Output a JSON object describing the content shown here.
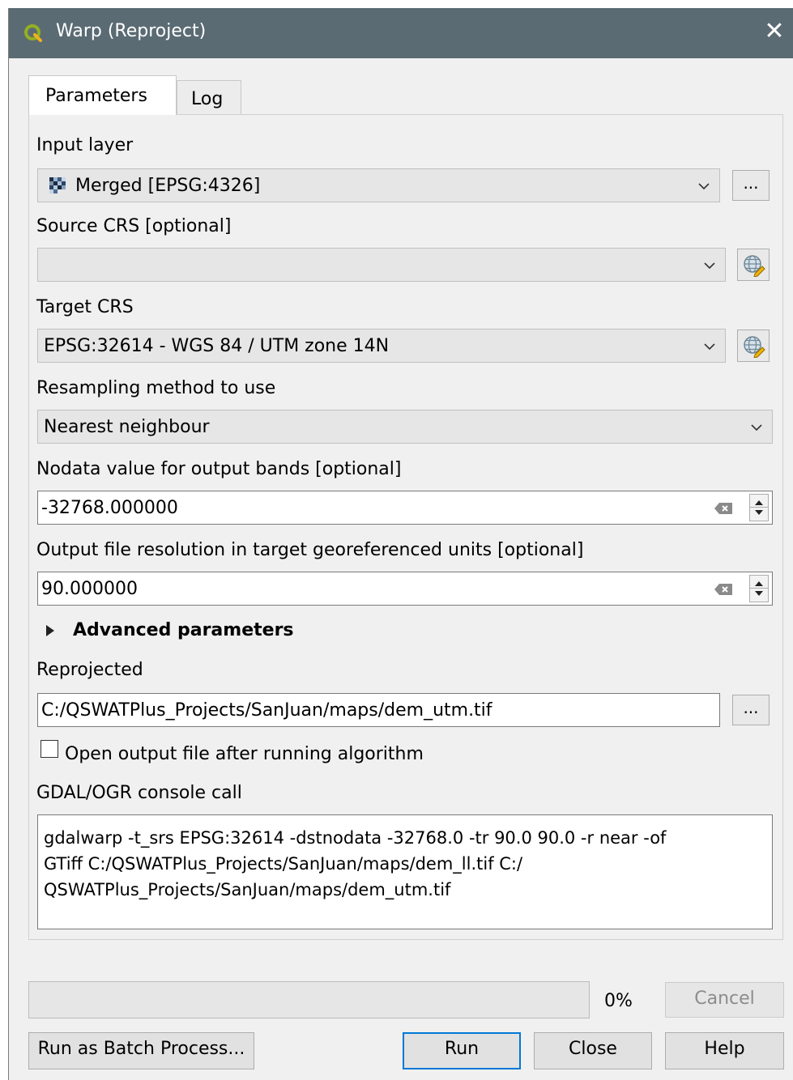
{
  "window": {
    "title": "Warp (Reproject)",
    "close_glyph": "✕",
    "app_icon": "qgis-logo-icon",
    "titlebar_color": "#5b6b73"
  },
  "tabs": [
    {
      "label": "Parameters",
      "active": true
    },
    {
      "label": "Log",
      "active": false
    }
  ],
  "params": {
    "input_layer": {
      "label": "Input layer",
      "value": "Merged [EPSG:4326]",
      "browse": "..."
    },
    "source_crs": {
      "label": "Source CRS [optional]",
      "value": ""
    },
    "target_crs": {
      "label": "Target CRS",
      "value": "EPSG:32614 - WGS 84 / UTM zone 14N"
    },
    "resampling": {
      "label": "Resampling method to use",
      "value": "Nearest neighbour"
    },
    "nodata": {
      "label": "Nodata value for output bands [optional]",
      "value": "-32768.000000"
    },
    "resolution": {
      "label": "Output file resolution in target georeferenced units [optional]",
      "value": "90.000000"
    },
    "advanced": {
      "label": "Advanced parameters"
    },
    "reprojected": {
      "label": "Reprojected",
      "value": "C:/QSWATPlus_Projects/SanJuan/maps/dem_utm.tif",
      "browse": "..."
    },
    "open_output": {
      "label": "Open output file after running algorithm",
      "checked": false
    },
    "console": {
      "label": "GDAL/OGR console call",
      "lines": [
        "gdalwarp -t_srs EPSG:32614 -dstnodata -32768.0 -tr 90.0 90.0 -r near -of",
        "GTiff C:/QSWATPlus_Projects/SanJuan/maps/dem_ll.tif C:/",
        "QSWATPlus_Projects/SanJuan/maps/dem_utm.tif"
      ]
    }
  },
  "footer": {
    "progress_text": "0%",
    "progress_value": 0,
    "cancel": "Cancel",
    "batch": "Run as Batch Process...",
    "run": "Run",
    "close": "Close",
    "help": "Help"
  }
}
